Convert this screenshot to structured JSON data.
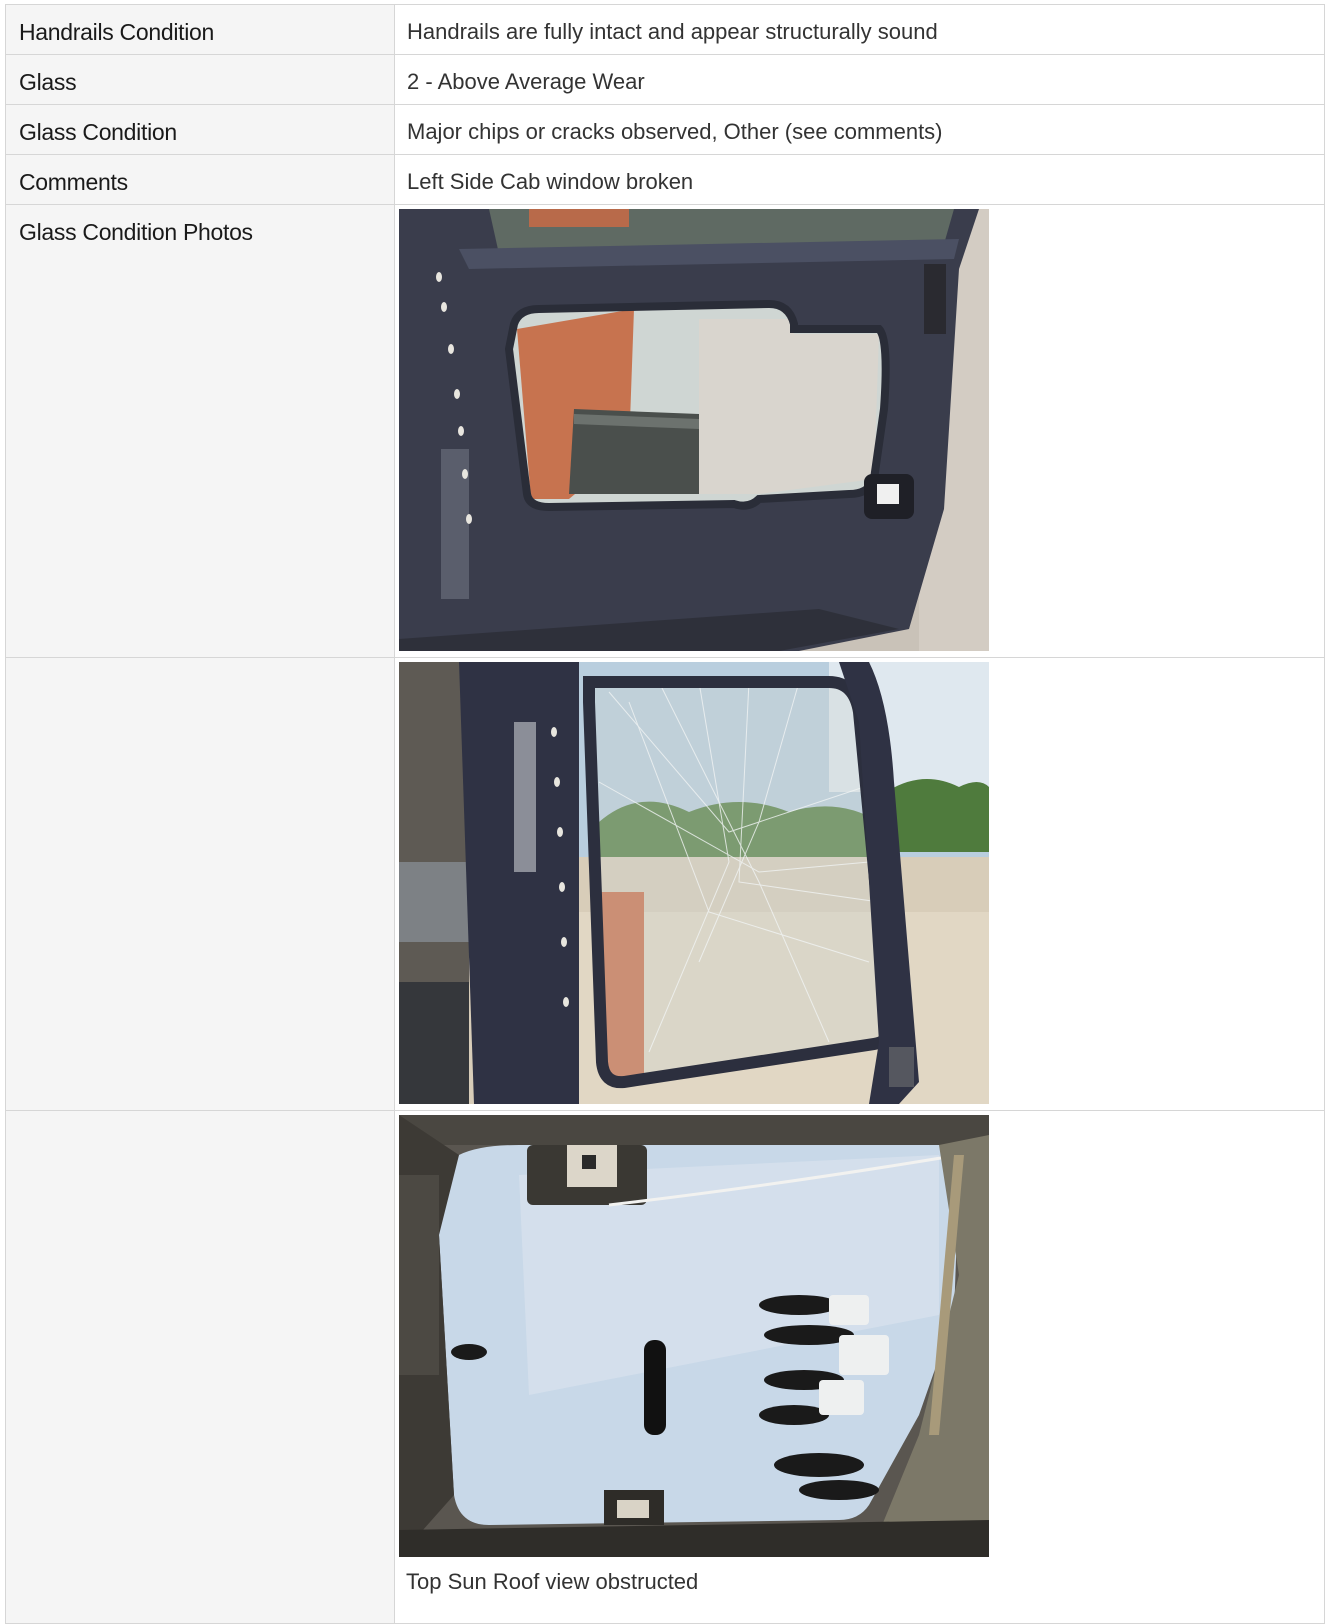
{
  "rows": [
    {
      "label": "Handrails Condition",
      "value": "Handrails are fully intact and appear structurally sound"
    },
    {
      "label": "Glass",
      "value": "2 - Above Average Wear"
    },
    {
      "label": "Glass Condition",
      "value": "Major chips or cracks observed, Other (see comments)"
    },
    {
      "label": "Comments",
      "value": "Left Side Cab window broken"
    }
  ],
  "photos_section": {
    "label": "Glass Condition Photos",
    "photos": [
      {
        "description": "cab door window frame with broken glass, gravel lot visible"
      },
      {
        "description": "shattered cab side window with trees and construction site"
      },
      {
        "description": "cab roof window with black spray paint marks"
      }
    ],
    "caption": "Top Sun Roof view obstructed"
  },
  "colors": {
    "label_bg": "#f5f5f5",
    "border": "#d6d6d6",
    "text": "#333333"
  }
}
